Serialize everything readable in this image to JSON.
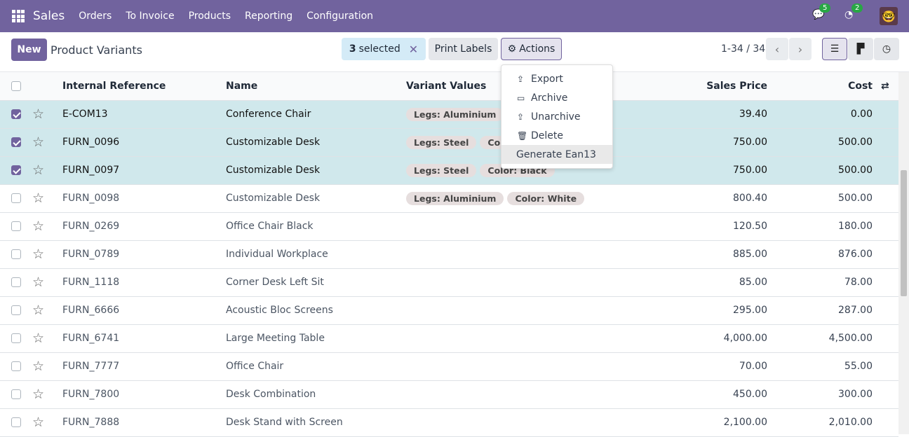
{
  "navbar": {
    "app": "Sales",
    "menus": [
      "Orders",
      "To Invoice",
      "Products",
      "Reporting",
      "Configuration"
    ],
    "messages_count": "5",
    "activities_count": "2"
  },
  "control": {
    "new_label": "New",
    "title": "Product Variants",
    "selected_count": "3",
    "selected_label": "selected",
    "print_labels": "Print Labels",
    "actions": "Actions",
    "pager": "1-34 / 34"
  },
  "actions_menu": [
    {
      "icon": "upload-icon",
      "label": "Export"
    },
    {
      "icon": "inbox-icon",
      "label": "Archive"
    },
    {
      "icon": "unarchive-icon",
      "label": "Unarchive"
    },
    {
      "icon": "trash-icon",
      "label": "Delete"
    },
    {
      "icon": "",
      "label": "Generate Ean13"
    }
  ],
  "columns": [
    "Internal Reference",
    "Name",
    "Variant Values",
    "Sales Price",
    "Cost"
  ],
  "rows": [
    {
      "selected": true,
      "ref": "E-COM13",
      "name": "Conference Chair",
      "variants": [
        "Legs: Aluminium"
      ],
      "price": "39.40",
      "cost": "0.00"
    },
    {
      "selected": true,
      "ref": "FURN_0096",
      "name": "Customizable Desk",
      "variants": [
        "Legs: Steel",
        "Color: White"
      ],
      "price": "750.00",
      "cost": "500.00"
    },
    {
      "selected": true,
      "ref": "FURN_0097",
      "name": "Customizable Desk",
      "variants": [
        "Legs: Steel",
        "Color: Black"
      ],
      "price": "750.00",
      "cost": "500.00"
    },
    {
      "selected": false,
      "ref": "FURN_0098",
      "name": "Customizable Desk",
      "variants": [
        "Legs: Aluminium",
        "Color: White"
      ],
      "price": "800.40",
      "cost": "500.00"
    },
    {
      "selected": false,
      "ref": "FURN_0269",
      "name": "Office Chair Black",
      "variants": [],
      "price": "120.50",
      "cost": "180.00"
    },
    {
      "selected": false,
      "ref": "FURN_0789",
      "name": "Individual Workplace",
      "variants": [],
      "price": "885.00",
      "cost": "876.00"
    },
    {
      "selected": false,
      "ref": "FURN_1118",
      "name": "Corner Desk Left Sit",
      "variants": [],
      "price": "85.00",
      "cost": "78.00"
    },
    {
      "selected": false,
      "ref": "FURN_6666",
      "name": "Acoustic Bloc Screens",
      "variants": [],
      "price": "295.00",
      "cost": "287.00"
    },
    {
      "selected": false,
      "ref": "FURN_6741",
      "name": "Large Meeting Table",
      "variants": [],
      "price": "4,000.00",
      "cost": "4,500.00"
    },
    {
      "selected": false,
      "ref": "FURN_7777",
      "name": "Office Chair",
      "variants": [],
      "price": "70.00",
      "cost": "55.00"
    },
    {
      "selected": false,
      "ref": "FURN_7800",
      "name": "Desk Combination",
      "variants": [],
      "price": "450.00",
      "cost": "300.00"
    },
    {
      "selected": false,
      "ref": "FURN_7888",
      "name": "Desk Stand with Screen",
      "variants": [],
      "price": "2,100.00",
      "cost": "2,010.00"
    }
  ],
  "colors": {
    "brand": "#71639e",
    "selected_row": "#d0e8ec",
    "badge": "#28a745"
  }
}
